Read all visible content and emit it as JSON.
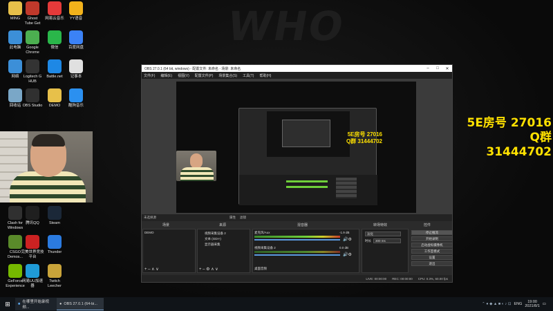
{
  "desktop": {
    "icons": [
      {
        "label": "MING",
        "icon": "folder-icon",
        "color": "#e7c04a"
      },
      {
        "label": "Ghost\nTube Get",
        "icon": "app-icon",
        "color": "#c0392b"
      },
      {
        "label": "网易云音乐",
        "icon": "music-icon",
        "color": "#e43a3a"
      },
      {
        "label": "YY语音",
        "icon": "yy-icon",
        "color": "#f2b21b"
      },
      {
        "label": "此电脑",
        "icon": "computer-icon",
        "color": "#3c8fd8"
      },
      {
        "label": "Google\nChrome",
        "icon": "chrome-icon",
        "color": "#4caf50"
      },
      {
        "label": "微信",
        "icon": "wechat-icon",
        "color": "#2ab64a"
      },
      {
        "label": "百度网盘",
        "icon": "cloud-icon",
        "color": "#3b82f6"
      },
      {
        "label": "网络",
        "icon": "network-icon",
        "color": "#3c8fd8"
      },
      {
        "label": "Logitech G\nHUB",
        "icon": "logitech-icon",
        "color": "#333333"
      },
      {
        "label": "Battle.net",
        "icon": "battlenet-icon",
        "color": "#1e88e5"
      },
      {
        "label": "记事本",
        "icon": "notepad-icon",
        "color": "#e0e0e0"
      },
      {
        "label": "回收站",
        "icon": "recycle-bin-icon",
        "color": "#7aa7c7"
      },
      {
        "label": "OBS Studio",
        "icon": "obs-icon",
        "color": "#303030"
      },
      {
        "label": "DEMO",
        "icon": "folder-icon",
        "color": "#e7c04a"
      },
      {
        "label": "酷狗音乐",
        "icon": "music-icon",
        "color": "#2b90f0"
      },
      {
        "label": "Clash for\nWindows",
        "icon": "clash-icon",
        "color": "#303030"
      },
      {
        "label": "腾讯QQ",
        "icon": "qq-icon",
        "color": "#1f1f1f"
      },
      {
        "label": "Steam",
        "icon": "steam-icon",
        "color": "#1b2838"
      },
      {
        "label": "CSGO\nDemos...",
        "icon": "csgo-icon",
        "color": "#5a8a2a"
      },
      {
        "label": "完美世界竞技\n平台",
        "icon": "perfect-world-icon",
        "color": "#c22"
      },
      {
        "label": "Thunder",
        "icon": "thunder-icon",
        "color": "#2b7be0"
      },
      {
        "label": "GeForce\nExperience",
        "icon": "nvidia-icon",
        "color": "#76b900"
      },
      {
        "label": "网易UU加速\n器",
        "icon": "uu-icon",
        "color": "#1f9bd7"
      },
      {
        "label": "Twitch\nLeecher",
        "icon": "twitch-icon",
        "color": "#c9a43a"
      }
    ]
  },
  "overlay": {
    "room_line": "5E房号 27016",
    "qq_line": "Q群 31444702"
  },
  "obs": {
    "title": "OBS 27.0.1 (64 bit, windows) - 配置文件: 未命名 - 场景: 未命名",
    "menu": [
      "文件(F)",
      "编辑(E)",
      "视图(V)",
      "配置文件(P)",
      "场景集合(S)",
      "工具(T)",
      "帮助(H)"
    ],
    "preview_overlay": {
      "room_line": "5E房号 27016",
      "qq_line": "Q群 31444702"
    },
    "source_bar": {
      "label": "未选择源",
      "props": "属性",
      "filters": "滤镜"
    },
    "docks": {
      "scenes": {
        "title": "场景",
        "items": [
          "DEMO"
        ]
      },
      "sources": {
        "title": "来源",
        "items": [
          "视频采集设备 2",
          "文本 (GDI+)",
          "显示器采集"
        ]
      },
      "mixer": {
        "title": "混音器",
        "channels": [
          {
            "name": "麦克风/Aux",
            "db": "-1.9 dB"
          },
          {
            "name": "视频采集设备 2",
            "db": "0.0 dB"
          },
          {
            "name": "桌面音频",
            "db": ""
          }
        ]
      },
      "transitions": {
        "title": "转场特效",
        "type": "淡化",
        "duration_label": "时长",
        "duration": "300 ms"
      },
      "controls": {
        "title": "控件",
        "buttons": [
          "停止推流",
          "开始录制",
          "启动虚拟摄像机",
          "工作室模式",
          "设置",
          "退出"
        ]
      }
    },
    "status": {
      "live": "LIVE: 00:00:00",
      "rec": "REC: 00:00:00",
      "cpu": "CPU: 0.3%, 60.00 fps"
    }
  },
  "taskbar": {
    "items": [
      {
        "label": "在哪里开始录视频..."
      },
      {
        "label": "OBS 27.0.1 (64-bi..."
      }
    ],
    "lang": "ENG",
    "time": "19:00",
    "date": "2021/8/1"
  }
}
